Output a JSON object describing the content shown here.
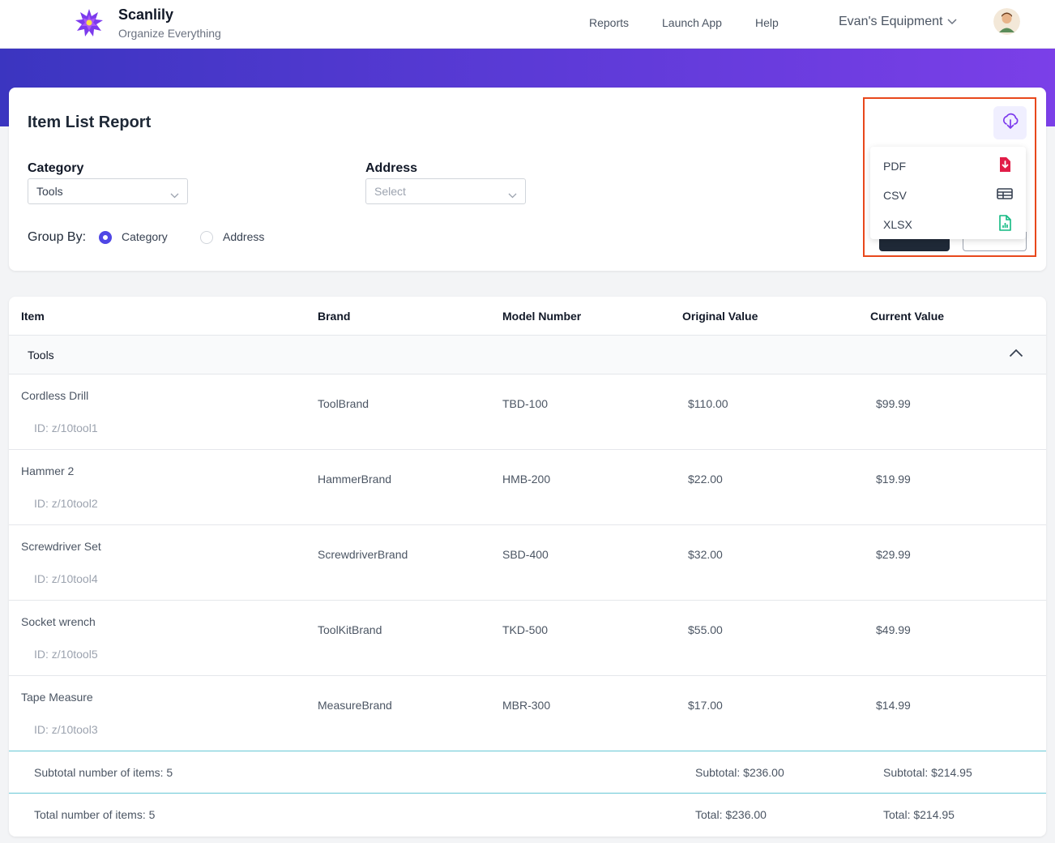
{
  "app": {
    "name": "Scanlily",
    "tagline": "Organize Everything"
  },
  "nav": {
    "items": [
      "Reports",
      "Launch App",
      "Help"
    ],
    "account": "Evan's Equipment"
  },
  "colors": {
    "accent": "#4f46e5",
    "banner_start": "#3b35c0",
    "banner_end": "#7b3fe8",
    "highlight": "#e8481c",
    "pdf": "#e11d48",
    "xlsx": "#10b981"
  },
  "report": {
    "title": "Item List Report",
    "category": {
      "label": "Category",
      "value": "Tools"
    },
    "address": {
      "label": "Address",
      "placeholder": "Select"
    },
    "group_by": {
      "label": "Group By:",
      "options": [
        "Category",
        "Address"
      ],
      "selected": "Category"
    }
  },
  "export": {
    "icon": "cloud-download-icon",
    "options": [
      {
        "label": "PDF",
        "icon": "pdf-file-icon"
      },
      {
        "label": "CSV",
        "icon": "table-icon"
      },
      {
        "label": "XLSX",
        "icon": "spreadsheet-icon"
      }
    ]
  },
  "table": {
    "columns": [
      "Item",
      "Brand",
      "Model Number",
      "Original Value",
      "Current Value"
    ],
    "group": "Tools",
    "rows": [
      {
        "item": "Cordless Drill",
        "id": "ID: z/10tool1",
        "brand": "ToolBrand",
        "model": "TBD-100",
        "original": "$110.00",
        "current": "$99.99"
      },
      {
        "item": "Hammer 2",
        "id": "ID: z/10tool2",
        "brand": "HammerBrand",
        "model": "HMB-200",
        "original": "$22.00",
        "current": "$19.99"
      },
      {
        "item": "Screwdriver Set",
        "id": "ID: z/10tool4",
        "brand": "ScrewdriverBrand",
        "model": "SBD-400",
        "original": "$32.00",
        "current": "$29.99"
      },
      {
        "item": "Socket wrench",
        "id": "ID: z/10tool5",
        "brand": "ToolKitBrand",
        "model": "TKD-500",
        "original": "$55.00",
        "current": "$49.99"
      },
      {
        "item": "Tape Measure",
        "id": "ID: z/10tool3",
        "brand": "MeasureBrand",
        "model": "MBR-300",
        "original": "$17.00",
        "current": "$14.99"
      }
    ],
    "subtotal": {
      "count": "Subtotal number of items: 5",
      "original": "Subtotal: $236.00",
      "current": "Subtotal: $214.95"
    },
    "total": {
      "count": "Total number of items: 5",
      "original": "Total: $236.00",
      "current": "Total: $214.95"
    }
  }
}
